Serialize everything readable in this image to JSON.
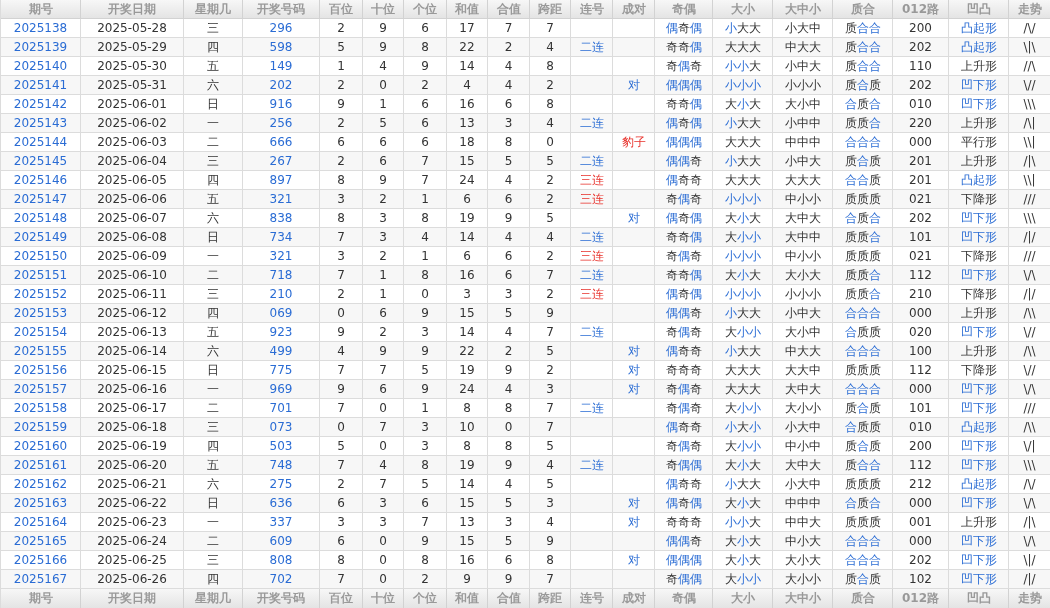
{
  "header": [
    "期号",
    "开奖日期",
    "星期几",
    "开奖号码",
    "百位",
    "十位",
    "个位",
    "和值",
    "合值",
    "跨距",
    "连号",
    "成对",
    "奇偶",
    "大小",
    "大中小",
    "质合",
    "012路",
    "凹凸",
    "走势"
  ],
  "rows": [
    {
      "issue": "2025138",
      "date": "2025-05-28",
      "weekday": "三",
      "number": "296",
      "hundreds": "2",
      "tens": "9",
      "units": "6",
      "sum": "17",
      "sum_tail": "7",
      "span": "7",
      "odd_even": [
        {
          "text": "偶",
          "highlighted": true
        },
        {
          "text": "奇",
          "highlighted": false
        },
        {
          "text": "偶",
          "highlighted": true
        }
      ],
      "big_small": [
        {
          "text": "小",
          "highlighted": true
        },
        {
          "text": "大",
          "highlighted": false
        },
        {
          "text": "大",
          "highlighted": false
        }
      ],
      "big_mid_small": "小大中",
      "prime_composite": [
        {
          "text": "质",
          "highlighted": false
        },
        {
          "text": "合",
          "highlighted": true
        },
        {
          "text": "合",
          "highlighted": true
        }
      ],
      "route_012": "200",
      "shape": {
        "text": "凸起形",
        "highlighted": true
      },
      "trend": "/\\/"
    },
    {
      "issue": "2025139",
      "date": "2025-05-29",
      "weekday": "四",
      "number": "598",
      "hundreds": "5",
      "tens": "9",
      "units": "8",
      "sum": "22",
      "sum_tail": "2",
      "span": "4",
      "consecutive": {
        "text": "二连",
        "alert": false
      },
      "odd_even": [
        {
          "text": "奇",
          "highlighted": false
        },
        {
          "text": "奇",
          "highlighted": false
        },
        {
          "text": "偶",
          "highlighted": true
        }
      ],
      "big_small": [
        {
          "text": "大",
          "highlighted": false
        },
        {
          "text": "大",
          "highlighted": false
        },
        {
          "text": "大",
          "highlighted": false
        }
      ],
      "big_mid_small": "中大大",
      "prime_composite": [
        {
          "text": "质",
          "highlighted": false
        },
        {
          "text": "合",
          "highlighted": true
        },
        {
          "text": "合",
          "highlighted": true
        }
      ],
      "route_012": "202",
      "shape": {
        "text": "凸起形",
        "highlighted": true
      },
      "trend": "\\|\\"
    },
    {
      "issue": "2025140",
      "date": "2025-05-30",
      "weekday": "五",
      "number": "149",
      "hundreds": "1",
      "tens": "4",
      "units": "9",
      "sum": "14",
      "sum_tail": "4",
      "span": "8",
      "odd_even": [
        {
          "text": "奇",
          "highlighted": false
        },
        {
          "text": "偶",
          "highlighted": true
        },
        {
          "text": "奇",
          "highlighted": false
        }
      ],
      "big_small": [
        {
          "text": "小",
          "highlighted": true
        },
        {
          "text": "小",
          "highlighted": true
        },
        {
          "text": "大",
          "highlighted": false
        }
      ],
      "big_mid_small": "小中大",
      "prime_composite": [
        {
          "text": "质",
          "highlighted": false
        },
        {
          "text": "合",
          "highlighted": true
        },
        {
          "text": "合",
          "highlighted": true
        }
      ],
      "route_012": "110",
      "shape": {
        "text": "上升形",
        "highlighted": false
      },
      "trend": "//\\"
    },
    {
      "issue": "2025141",
      "date": "2025-05-31",
      "weekday": "六",
      "number": "202",
      "hundreds": "2",
      "tens": "0",
      "units": "2",
      "sum": "4",
      "sum_tail": "4",
      "span": "2",
      "pair": {
        "text": "对",
        "alert": false
      },
      "odd_even": [
        {
          "text": "偶",
          "highlighted": true
        },
        {
          "text": "偶",
          "highlighted": true
        },
        {
          "text": "偶",
          "highlighted": true
        }
      ],
      "big_small": [
        {
          "text": "小",
          "highlighted": true
        },
        {
          "text": "小",
          "highlighted": true
        },
        {
          "text": "小",
          "highlighted": true
        }
      ],
      "big_mid_small": "小小小",
      "prime_composite": [
        {
          "text": "质",
          "highlighted": false
        },
        {
          "text": "合",
          "highlighted": true
        },
        {
          "text": "质",
          "highlighted": false
        }
      ],
      "route_012": "202",
      "shape": {
        "text": "凹下形",
        "highlighted": true
      },
      "trend": "\\//"
    },
    {
      "issue": "2025142",
      "date": "2025-06-01",
      "weekday": "日",
      "number": "916",
      "hundreds": "9",
      "tens": "1",
      "units": "6",
      "sum": "16",
      "sum_tail": "6",
      "span": "8",
      "odd_even": [
        {
          "text": "奇",
          "highlighted": false
        },
        {
          "text": "奇",
          "highlighted": false
        },
        {
          "text": "偶",
          "highlighted": true
        }
      ],
      "big_small": [
        {
          "text": "大",
          "highlighted": false
        },
        {
          "text": "小",
          "highlighted": true
        },
        {
          "text": "大",
          "highlighted": false
        }
      ],
      "big_mid_small": "大小中",
      "prime_composite": [
        {
          "text": "合",
          "highlighted": true
        },
        {
          "text": "质",
          "highlighted": false
        },
        {
          "text": "合",
          "highlighted": true
        }
      ],
      "route_012": "010",
      "shape": {
        "text": "凹下形",
        "highlighted": true
      },
      "trend": "\\\\\\"
    },
    {
      "issue": "2025143",
      "date": "2025-06-02",
      "weekday": "一",
      "number": "256",
      "hundreds": "2",
      "tens": "5",
      "units": "6",
      "sum": "13",
      "sum_tail": "3",
      "span": "4",
      "consecutive": {
        "text": "二连",
        "alert": false
      },
      "odd_even": [
        {
          "text": "偶",
          "highlighted": true
        },
        {
          "text": "奇",
          "highlighted": false
        },
        {
          "text": "偶",
          "highlighted": true
        }
      ],
      "big_small": [
        {
          "text": "小",
          "highlighted": true
        },
        {
          "text": "大",
          "highlighted": false
        },
        {
          "text": "大",
          "highlighted": false
        }
      ],
      "big_mid_small": "小中中",
      "prime_composite": [
        {
          "text": "质",
          "highlighted": false
        },
        {
          "text": "质",
          "highlighted": false
        },
        {
          "text": "合",
          "highlighted": true
        }
      ],
      "route_012": "220",
      "shape": {
        "text": "上升形",
        "highlighted": false
      },
      "trend": "/\\|"
    },
    {
      "issue": "2025144",
      "date": "2025-06-03",
      "weekday": "二",
      "number": "666",
      "hundreds": "6",
      "tens": "6",
      "units": "6",
      "sum": "18",
      "sum_tail": "8",
      "span": "0",
      "pair": {
        "text": "豹子",
        "alert": true
      },
      "odd_even": [
        {
          "text": "偶",
          "highlighted": true
        },
        {
          "text": "偶",
          "highlighted": true
        },
        {
          "text": "偶",
          "highlighted": true
        }
      ],
      "big_small": [
        {
          "text": "大",
          "highlighted": false
        },
        {
          "text": "大",
          "highlighted": false
        },
        {
          "text": "大",
          "highlighted": false
        }
      ],
      "big_mid_small": "中中中",
      "prime_composite": [
        {
          "text": "合",
          "highlighted": true
        },
        {
          "text": "合",
          "highlighted": true
        },
        {
          "text": "合",
          "highlighted": true
        }
      ],
      "route_012": "000",
      "shape": {
        "text": "平行形",
        "highlighted": false
      },
      "trend": "\\\\|"
    },
    {
      "issue": "2025145",
      "date": "2025-06-04",
      "weekday": "三",
      "number": "267",
      "hundreds": "2",
      "tens": "6",
      "units": "7",
      "sum": "15",
      "sum_tail": "5",
      "span": "5",
      "consecutive": {
        "text": "二连",
        "alert": false
      },
      "odd_even": [
        {
          "text": "偶",
          "highlighted": true
        },
        {
          "text": "偶",
          "highlighted": true
        },
        {
          "text": "奇",
          "highlighted": false
        }
      ],
      "big_small": [
        {
          "text": "小",
          "highlighted": true
        },
        {
          "text": "大",
          "highlighted": false
        },
        {
          "text": "大",
          "highlighted": false
        }
      ],
      "big_mid_small": "小中大",
      "prime_composite": [
        {
          "text": "质",
          "highlighted": false
        },
        {
          "text": "合",
          "highlighted": true
        },
        {
          "text": "质",
          "highlighted": false
        }
      ],
      "route_012": "201",
      "shape": {
        "text": "上升形",
        "highlighted": false
      },
      "trend": "/|\\"
    },
    {
      "issue": "2025146",
      "date": "2025-06-05",
      "weekday": "四",
      "number": "897",
      "hundreds": "8",
      "tens": "9",
      "units": "7",
      "sum": "24",
      "sum_tail": "4",
      "span": "2",
      "consecutive": {
        "text": "三连",
        "alert": true
      },
      "odd_even": [
        {
          "text": "偶",
          "highlighted": true
        },
        {
          "text": "奇",
          "highlighted": false
        },
        {
          "text": "奇",
          "highlighted": false
        }
      ],
      "big_small": [
        {
          "text": "大",
          "highlighted": false
        },
        {
          "text": "大",
          "highlighted": false
        },
        {
          "text": "大",
          "highlighted": false
        }
      ],
      "big_mid_small": "大大大",
      "prime_composite": [
        {
          "text": "合",
          "highlighted": true
        },
        {
          "text": "合",
          "highlighted": true
        },
        {
          "text": "质",
          "highlighted": false
        }
      ],
      "route_012": "201",
      "shape": {
        "text": "凸起形",
        "highlighted": true
      },
      "trend": "\\\\|"
    },
    {
      "issue": "2025147",
      "date": "2025-06-06",
      "weekday": "五",
      "number": "321",
      "hundreds": "3",
      "tens": "2",
      "units": "1",
      "sum": "6",
      "sum_tail": "6",
      "span": "2",
      "consecutive": {
        "text": "三连",
        "alert": true
      },
      "odd_even": [
        {
          "text": "奇",
          "highlighted": false
        },
        {
          "text": "偶",
          "highlighted": true
        },
        {
          "text": "奇",
          "highlighted": false
        }
      ],
      "big_small": [
        {
          "text": "小",
          "highlighted": true
        },
        {
          "text": "小",
          "highlighted": true
        },
        {
          "text": "小",
          "highlighted": true
        }
      ],
      "big_mid_small": "中小小",
      "prime_composite": [
        {
          "text": "质",
          "highlighted": false
        },
        {
          "text": "质",
          "highlighted": false
        },
        {
          "text": "质",
          "highlighted": false
        }
      ],
      "route_012": "021",
      "shape": {
        "text": "下降形",
        "highlighted": false
      },
      "trend": "///"
    },
    {
      "issue": "2025148",
      "date": "2025-06-07",
      "weekday": "六",
      "number": "838",
      "hundreds": "8",
      "tens": "3",
      "units": "8",
      "sum": "19",
      "sum_tail": "9",
      "span": "5",
      "pair": {
        "text": "对",
        "alert": false
      },
      "odd_even": [
        {
          "text": "偶",
          "highlighted": true
        },
        {
          "text": "奇",
          "highlighted": false
        },
        {
          "text": "偶",
          "highlighted": true
        }
      ],
      "big_small": [
        {
          "text": "大",
          "highlighted": false
        },
        {
          "text": "小",
          "highlighted": true
        },
        {
          "text": "大",
          "highlighted": false
        }
      ],
      "big_mid_small": "大中大",
      "prime_composite": [
        {
          "text": "合",
          "highlighted": true
        },
        {
          "text": "质",
          "highlighted": false
        },
        {
          "text": "合",
          "highlighted": true
        }
      ],
      "route_012": "202",
      "shape": {
        "text": "凹下形",
        "highlighted": true
      },
      "trend": "\\\\\\"
    },
    {
      "issue": "2025149",
      "date": "2025-06-08",
      "weekday": "日",
      "number": "734",
      "hundreds": "7",
      "tens": "3",
      "units": "4",
      "sum": "14",
      "sum_tail": "4",
      "span": "4",
      "consecutive": {
        "text": "二连",
        "alert": false
      },
      "odd_even": [
        {
          "text": "奇",
          "highlighted": false
        },
        {
          "text": "奇",
          "highlighted": false
        },
        {
          "text": "偶",
          "highlighted": true
        }
      ],
      "big_small": [
        {
          "text": "大",
          "highlighted": false
        },
        {
          "text": "小",
          "highlighted": true
        },
        {
          "text": "小",
          "highlighted": true
        }
      ],
      "big_mid_small": "大中中",
      "prime_composite": [
        {
          "text": "质",
          "highlighted": false
        },
        {
          "text": "质",
          "highlighted": false
        },
        {
          "text": "合",
          "highlighted": true
        }
      ],
      "route_012": "101",
      "shape": {
        "text": "凹下形",
        "highlighted": true
      },
      "trend": "/|/"
    },
    {
      "issue": "2025150",
      "date": "2025-06-09",
      "weekday": "一",
      "number": "321",
      "hundreds": "3",
      "tens": "2",
      "units": "1",
      "sum": "6",
      "sum_tail": "6",
      "span": "2",
      "consecutive": {
        "text": "三连",
        "alert": true
      },
      "odd_even": [
        {
          "text": "奇",
          "highlighted": false
        },
        {
          "text": "偶",
          "highlighted": true
        },
        {
          "text": "奇",
          "highlighted": false
        }
      ],
      "big_small": [
        {
          "text": "小",
          "highlighted": true
        },
        {
          "text": "小",
          "highlighted": true
        },
        {
          "text": "小",
          "highlighted": true
        }
      ],
      "big_mid_small": "中小小",
      "prime_composite": [
        {
          "text": "质",
          "highlighted": false
        },
        {
          "text": "质",
          "highlighted": false
        },
        {
          "text": "质",
          "highlighted": false
        }
      ],
      "route_012": "021",
      "shape": {
        "text": "下降形",
        "highlighted": false
      },
      "trend": "///"
    },
    {
      "issue": "2025151",
      "date": "2025-06-10",
      "weekday": "二",
      "number": "718",
      "hundreds": "7",
      "tens": "1",
      "units": "8",
      "sum": "16",
      "sum_tail": "6",
      "span": "7",
      "consecutive": {
        "text": "二连",
        "alert": false
      },
      "odd_even": [
        {
          "text": "奇",
          "highlighted": false
        },
        {
          "text": "奇",
          "highlighted": false
        },
        {
          "text": "偶",
          "highlighted": true
        }
      ],
      "big_small": [
        {
          "text": "大",
          "highlighted": false
        },
        {
          "text": "小",
          "highlighted": true
        },
        {
          "text": "大",
          "highlighted": false
        }
      ],
      "big_mid_small": "大小大",
      "prime_composite": [
        {
          "text": "质",
          "highlighted": false
        },
        {
          "text": "质",
          "highlighted": false
        },
        {
          "text": "合",
          "highlighted": true
        }
      ],
      "route_012": "112",
      "shape": {
        "text": "凹下形",
        "highlighted": true
      },
      "trend": "\\/\\"
    },
    {
      "issue": "2025152",
      "date": "2025-06-11",
      "weekday": "三",
      "number": "210",
      "hundreds": "2",
      "tens": "1",
      "units": "0",
      "sum": "3",
      "sum_tail": "3",
      "span": "2",
      "consecutive": {
        "text": "三连",
        "alert": true
      },
      "odd_even": [
        {
          "text": "偶",
          "highlighted": true
        },
        {
          "text": "奇",
          "highlighted": false
        },
        {
          "text": "偶",
          "highlighted": true
        }
      ],
      "big_small": [
        {
          "text": "小",
          "highlighted": true
        },
        {
          "text": "小",
          "highlighted": true
        },
        {
          "text": "小",
          "highlighted": true
        }
      ],
      "big_mid_small": "小小小",
      "prime_composite": [
        {
          "text": "质",
          "highlighted": false
        },
        {
          "text": "质",
          "highlighted": false
        },
        {
          "text": "合",
          "highlighted": true
        }
      ],
      "route_012": "210",
      "shape": {
        "text": "下降形",
        "highlighted": false
      },
      "trend": "/|/"
    },
    {
      "issue": "2025153",
      "date": "2025-06-12",
      "weekday": "四",
      "number": "069",
      "hundreds": "0",
      "tens": "6",
      "units": "9",
      "sum": "15",
      "sum_tail": "5",
      "span": "9",
      "odd_even": [
        {
          "text": "偶",
          "highlighted": true
        },
        {
          "text": "偶",
          "highlighted": true
        },
        {
          "text": "奇",
          "highlighted": false
        }
      ],
      "big_small": [
        {
          "text": "小",
          "highlighted": true
        },
        {
          "text": "大",
          "highlighted": false
        },
        {
          "text": "大",
          "highlighted": false
        }
      ],
      "big_mid_small": "小中大",
      "prime_composite": [
        {
          "text": "合",
          "highlighted": true
        },
        {
          "text": "合",
          "highlighted": true
        },
        {
          "text": "合",
          "highlighted": true
        }
      ],
      "route_012": "000",
      "shape": {
        "text": "上升形",
        "highlighted": false
      },
      "trend": "/\\\\"
    },
    {
      "issue": "2025154",
      "date": "2025-06-13",
      "weekday": "五",
      "number": "923",
      "hundreds": "9",
      "tens": "2",
      "units": "3",
      "sum": "14",
      "sum_tail": "4",
      "span": "7",
      "consecutive": {
        "text": "二连",
        "alert": false
      },
      "odd_even": [
        {
          "text": "奇",
          "highlighted": false
        },
        {
          "text": "偶",
          "highlighted": true
        },
        {
          "text": "奇",
          "highlighted": false
        }
      ],
      "big_small": [
        {
          "text": "大",
          "highlighted": false
        },
        {
          "text": "小",
          "highlighted": true
        },
        {
          "text": "小",
          "highlighted": true
        }
      ],
      "big_mid_small": "大小中",
      "prime_composite": [
        {
          "text": "合",
          "highlighted": true
        },
        {
          "text": "质",
          "highlighted": false
        },
        {
          "text": "质",
          "highlighted": false
        }
      ],
      "route_012": "020",
      "shape": {
        "text": "凹下形",
        "highlighted": true
      },
      "trend": "\\//"
    },
    {
      "issue": "2025155",
      "date": "2025-06-14",
      "weekday": "六",
      "number": "499",
      "hundreds": "4",
      "tens": "9",
      "units": "9",
      "sum": "22",
      "sum_tail": "2",
      "span": "5",
      "pair": {
        "text": "对",
        "alert": false
      },
      "odd_even": [
        {
          "text": "偶",
          "highlighted": true
        },
        {
          "text": "奇",
          "highlighted": false
        },
        {
          "text": "奇",
          "highlighted": false
        }
      ],
      "big_small": [
        {
          "text": "小",
          "highlighted": true
        },
        {
          "text": "大",
          "highlighted": false
        },
        {
          "text": "大",
          "highlighted": false
        }
      ],
      "big_mid_small": "中大大",
      "prime_composite": [
        {
          "text": "合",
          "highlighted": true
        },
        {
          "text": "合",
          "highlighted": true
        },
        {
          "text": "合",
          "highlighted": true
        }
      ],
      "route_012": "100",
      "shape": {
        "text": "上升形",
        "highlighted": false
      },
      "trend": "/\\\\"
    },
    {
      "issue": "2025156",
      "date": "2025-06-15",
      "weekday": "日",
      "number": "775",
      "hundreds": "7",
      "tens": "7",
      "units": "5",
      "sum": "19",
      "sum_tail": "9",
      "span": "2",
      "pair": {
        "text": "对",
        "alert": false
      },
      "odd_even": [
        {
          "text": "奇",
          "highlighted": false
        },
        {
          "text": "奇",
          "highlighted": false
        },
        {
          "text": "奇",
          "highlighted": false
        }
      ],
      "big_small": [
        {
          "text": "大",
          "highlighted": false
        },
        {
          "text": "大",
          "highlighted": false
        },
        {
          "text": "大",
          "highlighted": false
        }
      ],
      "big_mid_small": "大大中",
      "prime_composite": [
        {
          "text": "质",
          "highlighted": false
        },
        {
          "text": "质",
          "highlighted": false
        },
        {
          "text": "质",
          "highlighted": false
        }
      ],
      "route_012": "112",
      "shape": {
        "text": "下降形",
        "highlighted": false
      },
      "trend": "\\//"
    },
    {
      "issue": "2025157",
      "date": "2025-06-16",
      "weekday": "一",
      "number": "969",
      "hundreds": "9",
      "tens": "6",
      "units": "9",
      "sum": "24",
      "sum_tail": "4",
      "span": "3",
      "pair": {
        "text": "对",
        "alert": false
      },
      "odd_even": [
        {
          "text": "奇",
          "highlighted": false
        },
        {
          "text": "偶",
          "highlighted": true
        },
        {
          "text": "奇",
          "highlighted": false
        }
      ],
      "big_small": [
        {
          "text": "大",
          "highlighted": false
        },
        {
          "text": "大",
          "highlighted": false
        },
        {
          "text": "大",
          "highlighted": false
        }
      ],
      "big_mid_small": "大中大",
      "prime_composite": [
        {
          "text": "合",
          "highlighted": true
        },
        {
          "text": "合",
          "highlighted": true
        },
        {
          "text": "合",
          "highlighted": true
        }
      ],
      "route_012": "000",
      "shape": {
        "text": "凹下形",
        "highlighted": true
      },
      "trend": "\\/\\"
    },
    {
      "issue": "2025158",
      "date": "2025-06-17",
      "weekday": "二",
      "number": "701",
      "hundreds": "7",
      "tens": "0",
      "units": "1",
      "sum": "8",
      "sum_tail": "8",
      "span": "7",
      "consecutive": {
        "text": "二连",
        "alert": false
      },
      "odd_even": [
        {
          "text": "奇",
          "highlighted": false
        },
        {
          "text": "偶",
          "highlighted": true
        },
        {
          "text": "奇",
          "highlighted": false
        }
      ],
      "big_small": [
        {
          "text": "大",
          "highlighted": false
        },
        {
          "text": "小",
          "highlighted": true
        },
        {
          "text": "小",
          "highlighted": true
        }
      ],
      "big_mid_small": "大小小",
      "prime_composite": [
        {
          "text": "质",
          "highlighted": false
        },
        {
          "text": "合",
          "highlighted": true
        },
        {
          "text": "质",
          "highlighted": false
        }
      ],
      "route_012": "101",
      "shape": {
        "text": "凹下形",
        "highlighted": true
      },
      "trend": "///"
    },
    {
      "issue": "2025159",
      "date": "2025-06-18",
      "weekday": "三",
      "number": "073",
      "hundreds": "0",
      "tens": "7",
      "units": "3",
      "sum": "10",
      "sum_tail": "0",
      "span": "7",
      "odd_even": [
        {
          "text": "偶",
          "highlighted": true
        },
        {
          "text": "奇",
          "highlighted": false
        },
        {
          "text": "奇",
          "highlighted": false
        }
      ],
      "big_small": [
        {
          "text": "小",
          "highlighted": true
        },
        {
          "text": "大",
          "highlighted": false
        },
        {
          "text": "小",
          "highlighted": true
        }
      ],
      "big_mid_small": "小大中",
      "prime_composite": [
        {
          "text": "合",
          "highlighted": true
        },
        {
          "text": "质",
          "highlighted": false
        },
        {
          "text": "质",
          "highlighted": false
        }
      ],
      "route_012": "010",
      "shape": {
        "text": "凸起形",
        "highlighted": true
      },
      "trend": "/\\\\"
    },
    {
      "issue": "2025160",
      "date": "2025-06-19",
      "weekday": "四",
      "number": "503",
      "hundreds": "5",
      "tens": "0",
      "units": "3",
      "sum": "8",
      "sum_tail": "8",
      "span": "5",
      "odd_even": [
        {
          "text": "奇",
          "highlighted": false
        },
        {
          "text": "偶",
          "highlighted": true
        },
        {
          "text": "奇",
          "highlighted": false
        }
      ],
      "big_small": [
        {
          "text": "大",
          "highlighted": false
        },
        {
          "text": "小",
          "highlighted": true
        },
        {
          "text": "小",
          "highlighted": true
        }
      ],
      "big_mid_small": "中小中",
      "prime_composite": [
        {
          "text": "质",
          "highlighted": false
        },
        {
          "text": "合",
          "highlighted": true
        },
        {
          "text": "质",
          "highlighted": false
        }
      ],
      "route_012": "200",
      "shape": {
        "text": "凹下形",
        "highlighted": true
      },
      "trend": "\\/|"
    },
    {
      "issue": "2025161",
      "date": "2025-06-20",
      "weekday": "五",
      "number": "748",
      "hundreds": "7",
      "tens": "4",
      "units": "8",
      "sum": "19",
      "sum_tail": "9",
      "span": "4",
      "consecutive": {
        "text": "二连",
        "alert": false
      },
      "odd_even": [
        {
          "text": "奇",
          "highlighted": false
        },
        {
          "text": "偶",
          "highlighted": true
        },
        {
          "text": "偶",
          "highlighted": true
        }
      ],
      "big_small": [
        {
          "text": "大",
          "highlighted": false
        },
        {
          "text": "小",
          "highlighted": true
        },
        {
          "text": "大",
          "highlighted": false
        }
      ],
      "big_mid_small": "大中大",
      "prime_composite": [
        {
          "text": "质",
          "highlighted": false
        },
        {
          "text": "合",
          "highlighted": true
        },
        {
          "text": "合",
          "highlighted": true
        }
      ],
      "route_012": "112",
      "shape": {
        "text": "凹下形",
        "highlighted": true
      },
      "trend": "\\\\\\"
    },
    {
      "issue": "2025162",
      "date": "2025-06-21",
      "weekday": "六",
      "number": "275",
      "hundreds": "2",
      "tens": "7",
      "units": "5",
      "sum": "14",
      "sum_tail": "4",
      "span": "5",
      "odd_even": [
        {
          "text": "偶",
          "highlighted": true
        },
        {
          "text": "奇",
          "highlighted": false
        },
        {
          "text": "奇",
          "highlighted": false
        }
      ],
      "big_small": [
        {
          "text": "小",
          "highlighted": true
        },
        {
          "text": "大",
          "highlighted": false
        },
        {
          "text": "大",
          "highlighted": false
        }
      ],
      "big_mid_small": "小大中",
      "prime_composite": [
        {
          "text": "质",
          "highlighted": false
        },
        {
          "text": "质",
          "highlighted": false
        },
        {
          "text": "质",
          "highlighted": false
        }
      ],
      "route_012": "212",
      "shape": {
        "text": "凸起形",
        "highlighted": true
      },
      "trend": "/\\/"
    },
    {
      "issue": "2025163",
      "date": "2025-06-22",
      "weekday": "日",
      "number": "636",
      "hundreds": "6",
      "tens": "3",
      "units": "6",
      "sum": "15",
      "sum_tail": "5",
      "span": "3",
      "pair": {
        "text": "对",
        "alert": false
      },
      "odd_even": [
        {
          "text": "偶",
          "highlighted": true
        },
        {
          "text": "奇",
          "highlighted": false
        },
        {
          "text": "偶",
          "highlighted": true
        }
      ],
      "big_small": [
        {
          "text": "大",
          "highlighted": false
        },
        {
          "text": "小",
          "highlighted": true
        },
        {
          "text": "大",
          "highlighted": false
        }
      ],
      "big_mid_small": "中中中",
      "prime_composite": [
        {
          "text": "合",
          "highlighted": true
        },
        {
          "text": "质",
          "highlighted": false
        },
        {
          "text": "合",
          "highlighted": true
        }
      ],
      "route_012": "000",
      "shape": {
        "text": "凹下形",
        "highlighted": true
      },
      "trend": "\\/\\"
    },
    {
      "issue": "2025164",
      "date": "2025-06-23",
      "weekday": "一",
      "number": "337",
      "hundreds": "3",
      "tens": "3",
      "units": "7",
      "sum": "13",
      "sum_tail": "3",
      "span": "4",
      "pair": {
        "text": "对",
        "alert": false
      },
      "odd_even": [
        {
          "text": "奇",
          "highlighted": false
        },
        {
          "text": "奇",
          "highlighted": false
        },
        {
          "text": "奇",
          "highlighted": false
        }
      ],
      "big_small": [
        {
          "text": "小",
          "highlighted": true
        },
        {
          "text": "小",
          "highlighted": true
        },
        {
          "text": "大",
          "highlighted": false
        }
      ],
      "big_mid_small": "中中大",
      "prime_composite": [
        {
          "text": "质",
          "highlighted": false
        },
        {
          "text": "质",
          "highlighted": false
        },
        {
          "text": "质",
          "highlighted": false
        }
      ],
      "route_012": "001",
      "shape": {
        "text": "上升形",
        "highlighted": false
      },
      "trend": "/|\\"
    },
    {
      "issue": "2025165",
      "date": "2025-06-24",
      "weekday": "二",
      "number": "609",
      "hundreds": "6",
      "tens": "0",
      "units": "9",
      "sum": "15",
      "sum_tail": "5",
      "span": "9",
      "odd_even": [
        {
          "text": "偶",
          "highlighted": true
        },
        {
          "text": "偶",
          "highlighted": true
        },
        {
          "text": "奇",
          "highlighted": false
        }
      ],
      "big_small": [
        {
          "text": "大",
          "highlighted": false
        },
        {
          "text": "小",
          "highlighted": true
        },
        {
          "text": "大",
          "highlighted": false
        }
      ],
      "big_mid_small": "中小大",
      "prime_composite": [
        {
          "text": "合",
          "highlighted": true
        },
        {
          "text": "合",
          "highlighted": true
        },
        {
          "text": "合",
          "highlighted": true
        }
      ],
      "route_012": "000",
      "shape": {
        "text": "凹下形",
        "highlighted": true
      },
      "trend": "\\/\\"
    },
    {
      "issue": "2025166",
      "date": "2025-06-25",
      "weekday": "三",
      "number": "808",
      "hundreds": "8",
      "tens": "0",
      "units": "8",
      "sum": "16",
      "sum_tail": "6",
      "span": "8",
      "pair": {
        "text": "对",
        "alert": false
      },
      "odd_even": [
        {
          "text": "偶",
          "highlighted": true
        },
        {
          "text": "偶",
          "highlighted": true
        },
        {
          "text": "偶",
          "highlighted": true
        }
      ],
      "big_small": [
        {
          "text": "大",
          "highlighted": false
        },
        {
          "text": "小",
          "highlighted": true
        },
        {
          "text": "大",
          "highlighted": false
        }
      ],
      "big_mid_small": "大小大",
      "prime_composite": [
        {
          "text": "合",
          "highlighted": true
        },
        {
          "text": "合",
          "highlighted": true
        },
        {
          "text": "合",
          "highlighted": true
        }
      ],
      "route_012": "202",
      "shape": {
        "text": "凹下形",
        "highlighted": true
      },
      "trend": "\\|/"
    },
    {
      "issue": "2025167",
      "date": "2025-06-26",
      "weekday": "四",
      "number": "702",
      "hundreds": "7",
      "tens": "0",
      "units": "2",
      "sum": "9",
      "sum_tail": "9",
      "span": "7",
      "odd_even": [
        {
          "text": "奇",
          "highlighted": false
        },
        {
          "text": "偶",
          "highlighted": true
        },
        {
          "text": "偶",
          "highlighted": true
        }
      ],
      "big_small": [
        {
          "text": "大",
          "highlighted": false
        },
        {
          "text": "小",
          "highlighted": true
        },
        {
          "text": "小",
          "highlighted": true
        }
      ],
      "big_mid_small": "大小小",
      "prime_composite": [
        {
          "text": "质",
          "highlighted": false
        },
        {
          "text": "合",
          "highlighted": true
        },
        {
          "text": "质",
          "highlighted": false
        }
      ],
      "route_012": "102",
      "shape": {
        "text": "凹下形",
        "highlighted": true
      },
      "trend": "/|/"
    }
  ],
  "footer": [
    "期号",
    "开奖日期",
    "星期几",
    "开奖号码",
    "百位",
    "十位",
    "个位",
    "和值",
    "合值",
    "跨距",
    "连号",
    "成对",
    "奇偶",
    "大小",
    "大中小",
    "质合",
    "012路",
    "凹凸",
    "走势"
  ]
}
